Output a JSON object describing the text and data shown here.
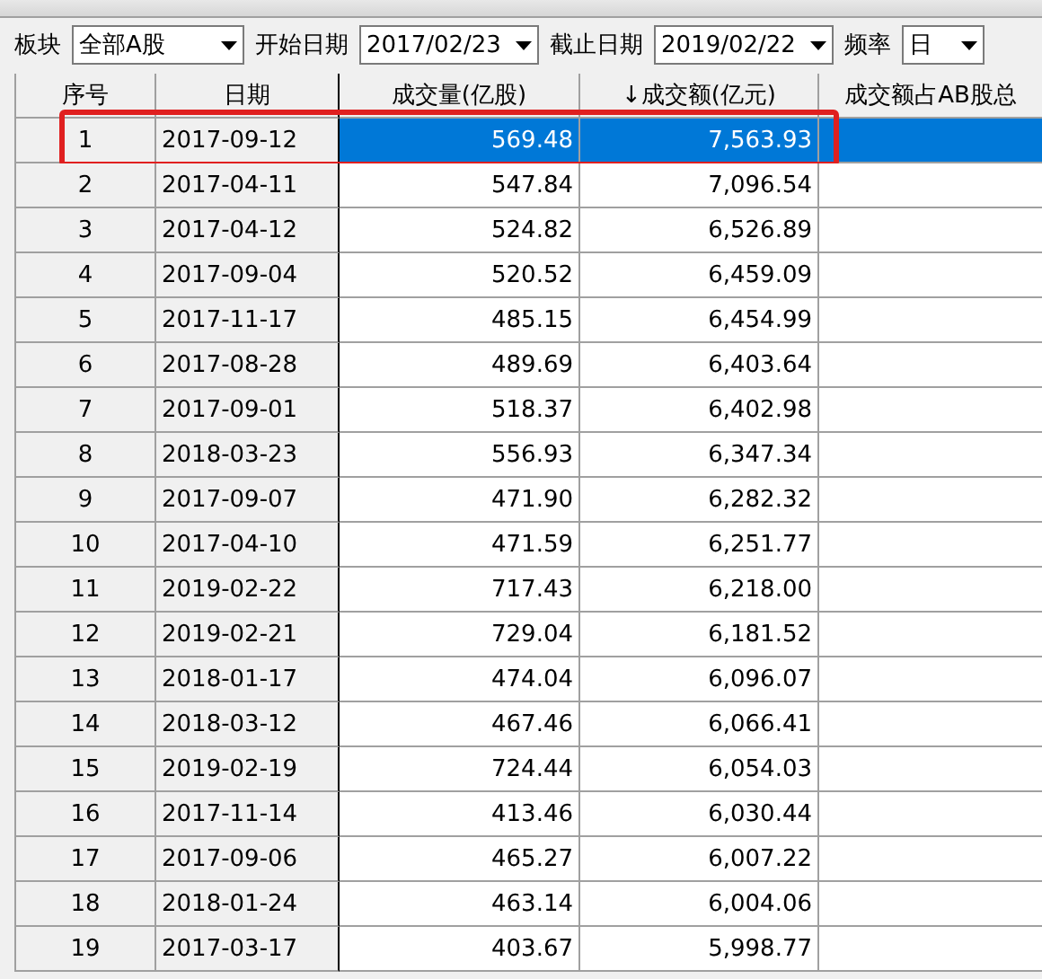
{
  "filters": [
    {
      "label": "板块",
      "value": "全部A股"
    },
    {
      "label": "开始日期",
      "value": "2017/02/23"
    },
    {
      "label": "截止日期",
      "value": "2019/02/22"
    },
    {
      "label": "频率",
      "value": "日"
    }
  ],
  "table": {
    "columns": [
      "序号",
      "日期",
      "成交量(亿股)",
      "↓成交额(亿元)",
      "成交额占AB股总"
    ],
    "rows": [
      {
        "cells": [
          "1",
          "2017-09-12",
          "569.48",
          "7,563.93"
        ],
        "selected": true,
        "annotated": true
      },
      {
        "cells": [
          "2",
          "2017-04-11",
          "547.84",
          "7,096.54"
        ],
        "selected": false,
        "annotated": false
      },
      {
        "cells": [
          "3",
          "2017-04-12",
          "524.82",
          "6,526.89"
        ],
        "selected": false,
        "annotated": false
      },
      {
        "cells": [
          "4",
          "2017-09-04",
          "520.52",
          "6,459.09"
        ],
        "selected": false,
        "annotated": false
      },
      {
        "cells": [
          "5",
          "2017-11-17",
          "485.15",
          "6,454.99"
        ],
        "selected": false,
        "annotated": false
      },
      {
        "cells": [
          "6",
          "2017-08-28",
          "489.69",
          "6,403.64"
        ],
        "selected": false,
        "annotated": false
      },
      {
        "cells": [
          "7",
          "2017-09-01",
          "518.37",
          "6,402.98"
        ],
        "selected": false,
        "annotated": false
      },
      {
        "cells": [
          "8",
          "2018-03-23",
          "556.93",
          "6,347.34"
        ],
        "selected": false,
        "annotated": false
      },
      {
        "cells": [
          "9",
          "2017-09-07",
          "471.90",
          "6,282.32"
        ],
        "selected": false,
        "annotated": false
      },
      {
        "cells": [
          "10",
          "2017-04-10",
          "471.59",
          "6,251.77"
        ],
        "selected": false,
        "annotated": false
      },
      {
        "cells": [
          "11",
          "2019-02-22",
          "717.43",
          "6,218.00"
        ],
        "selected": false,
        "annotated": false
      },
      {
        "cells": [
          "12",
          "2019-02-21",
          "729.04",
          "6,181.52"
        ],
        "selected": false,
        "annotated": false
      },
      {
        "cells": [
          "13",
          "2018-01-17",
          "474.04",
          "6,096.07"
        ],
        "selected": false,
        "annotated": false
      },
      {
        "cells": [
          "14",
          "2018-03-12",
          "467.46",
          "6,066.41"
        ],
        "selected": false,
        "annotated": false
      },
      {
        "cells": [
          "15",
          "2019-02-19",
          "724.44",
          "6,054.03"
        ],
        "selected": false,
        "annotated": false
      },
      {
        "cells": [
          "16",
          "2017-11-14",
          "413.46",
          "6,030.44"
        ],
        "selected": false,
        "annotated": false
      },
      {
        "cells": [
          "17",
          "2017-09-06",
          "465.27",
          "6,007.22"
        ],
        "selected": false,
        "annotated": false
      },
      {
        "cells": [
          "18",
          "2018-01-24",
          "463.14",
          "6,004.06"
        ],
        "selected": false,
        "annotated": false
      },
      {
        "cells": [
          "19",
          "2017-03-17",
          "403.67",
          "5,998.77"
        ],
        "selected": false,
        "annotated": false
      }
    ]
  }
}
